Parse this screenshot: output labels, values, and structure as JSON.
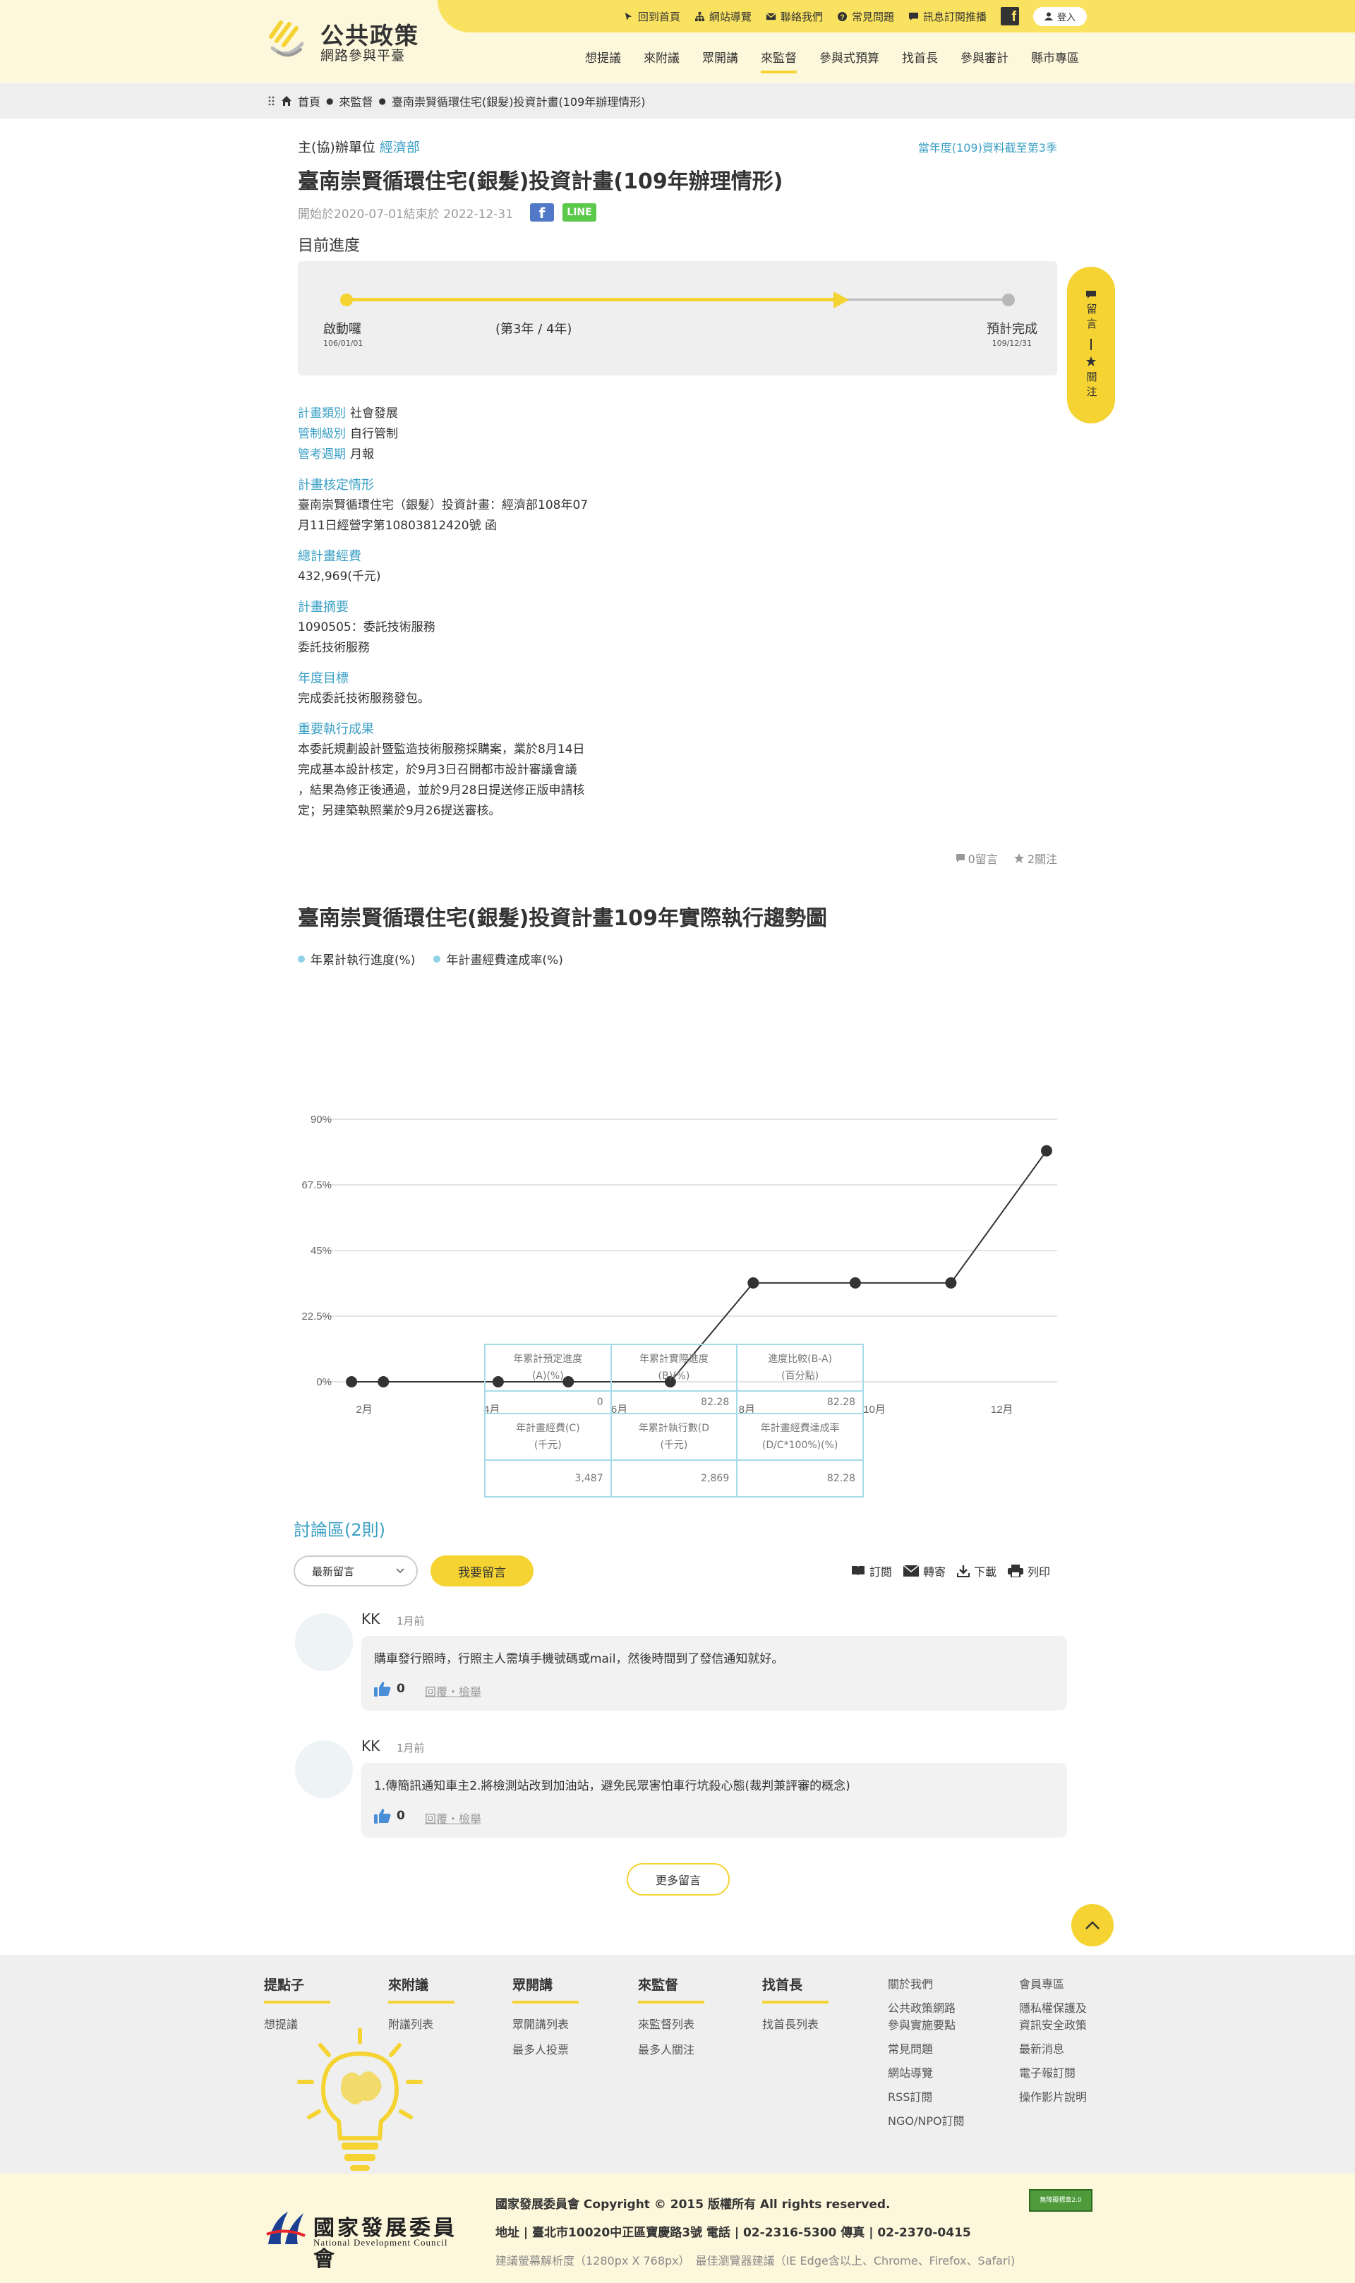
{
  "header": {
    "logo_title": "公共政策",
    "logo_subtitle": "網路參與平臺",
    "toplinks": [
      "回到首頁",
      "網站導覽",
      "聯絡我們",
      "常見問題",
      "訊息訂閱推播"
    ],
    "fb_letter": "f",
    "login": "登入",
    "nav": [
      "想提議",
      "來附議",
      "眾開講",
      "來監督",
      "參與式預算",
      "找首長",
      "參與審計",
      "縣市專區"
    ],
    "active_nav": "來監督"
  },
  "breadcrumb": [
    "首頁",
    "來監督",
    "臺南崇賢循環住宅(銀髮)投資計畫(109年辦理情形)"
  ],
  "plan": {
    "org_label": "主(協)辦單位",
    "org": "經濟部",
    "data_through": "當年度(109)資料截至第3季",
    "title": "臺南崇賢循環住宅(銀髮)投資計畫(109年辦理情形)",
    "date_range": "開始於2020-07-01結束於 2022-12-31",
    "line_label": "LINE",
    "progress_label": "目前進度",
    "progress": {
      "start_label": "啟動囉",
      "start_date": "106/01/01",
      "mid_label": "(第3年 / 4年)",
      "end_label": "預計完成",
      "end_date": "109/12/31",
      "fraction": 0.75
    },
    "side_float": {
      "comment": "留言",
      "follow": "關注"
    },
    "category_label": "計畫類別",
    "category": "社會發展",
    "control_label": "管制級別",
    "control": "自行管制",
    "cycle_label": "管考週期",
    "cycle": "月報",
    "approval_title": "計畫核定情形",
    "approval_lines": [
      "臺南崇賢循環住宅（銀髮）投資計畫：經濟部108年07",
      "月11日經營字第10803812420號 函"
    ],
    "budget_title": "總計畫經費",
    "budget": "432,969(千元)",
    "summary_title": "計畫摘要",
    "summary_lines": [
      "1090505：委託技術服務",
      "委託技術服務"
    ],
    "goal_title": "年度目標",
    "goal": "完成委託技術服務發包。",
    "result_title": "重要執行成果",
    "result_lines": [
      "本委託規劃設計暨監造技術服務採購案，業於8月14日",
      "完成基本設計核定，於9月3日召開都市設計審議會議",
      "，結果為修正後通過，並於9月28日提送修正版申請核",
      "定；另建築執照業於9月26提送審核。"
    ],
    "comments_count": "0留言",
    "follows_count": "2關注"
  },
  "chart_data": {
    "type": "line",
    "title": "臺南崇賢循環住宅(銀髮)投資計畫109年實際執行趨勢圖",
    "legend": [
      "年累計執行進度(%)",
      "年計畫經費達成率(%)"
    ],
    "yticks": [
      "90%",
      "67.5%",
      "45%",
      "22.5%",
      "0%"
    ],
    "xticks": [
      "2月",
      "4月",
      "6月",
      "8月",
      "10月",
      "12月"
    ],
    "ylim": [
      0,
      90
    ],
    "grid": true,
    "series": [
      {
        "name": "年累計執行進度(%)",
        "x": [
          1.8,
          2.3,
          4.1,
          5.2,
          6.8,
          8.1,
          9.7,
          11.2,
          12.7
        ],
        "y": [
          0,
          0,
          0,
          0,
          0,
          33.9,
          33.9,
          33.9,
          79.2
        ]
      }
    ]
  },
  "table": {
    "headers1": [
      "年累計預定進度\n(A)(%)",
      "年累計實際進度\n(B)(%)",
      "進度比較(B-A)\n(百分點)"
    ],
    "row1": [
      "0",
      "82.28",
      "82.28"
    ],
    "headers2": [
      "年計畫經費(C)\n(千元)",
      "年累計執行數(D\n(千元)",
      "年計畫經費達成率\n(D/C*100%)(%)"
    ],
    "row2": [
      "3,487",
      "2,869",
      "82.28"
    ]
  },
  "discussion": {
    "title": "討論區(2則)",
    "sort": "最新留言",
    "comment_btn": "我要留言",
    "tools": [
      "訂閱",
      "轉寄",
      "下載",
      "列印"
    ],
    "comments": [
      {
        "author": "KK",
        "time": "1月前",
        "text": "購車發行照時，行照主人需填手機號碼或mail，然後時間到了發信通知就好。",
        "likes": "0",
        "actions": "回覆・檢舉"
      },
      {
        "author": "KK",
        "time": "1月前",
        "text": "1.傳簡訊通知車主2.將檢測站改到加油站，避免民眾害怕車行坑殺心態(裁判兼評審的概念)",
        "likes": "0",
        "actions": "回覆・檢舉"
      }
    ],
    "more": "更多留言"
  },
  "footer": {
    "cols": [
      {
        "title": "提點子",
        "links": [
          "想提議"
        ]
      },
      {
        "title": "來附議",
        "links": [
          "附議列表"
        ]
      },
      {
        "title": "眾開講",
        "links": [
          "眾開講列表",
          "最多人投票"
        ]
      },
      {
        "title": "來監督",
        "links": [
          "來監督列表",
          "最多人關注"
        ]
      },
      {
        "title": "找首長",
        "links": [
          "找首長列表"
        ]
      }
    ],
    "links_a": [
      "關於我們",
      "公共政策網路\n參與實施要點",
      "常見問題",
      "網站導覽",
      "RSS訂閱",
      "NGO/NPO訂閱"
    ],
    "links_b": [
      "會員專區",
      "隱私權保護及\n資訊安全政策",
      "最新消息",
      "電子報訂閱",
      "操作影片說明"
    ],
    "ndc_name": "國家發展委員會",
    "ndc_en": "National Development Council",
    "copyright": "國家發展委員會 Copyright © 2015 版權所有 All rights reserved.",
    "address": "地址 | 臺北市10020中正區寶慶路3號 電話 | 02-2316-5300 傳真 | 02-2370-0415",
    "browser": "建議螢幕解析度（1280px X 768px）　最佳瀏覽器建議（IE Edge含以上、Chrome、Firefox、Safari)",
    "a11y_badge": "無障礙標章2.0"
  },
  "colors": {
    "accent": "#f4d332",
    "link": "#3a9fc5",
    "header_bg": "#fdf8dc"
  }
}
